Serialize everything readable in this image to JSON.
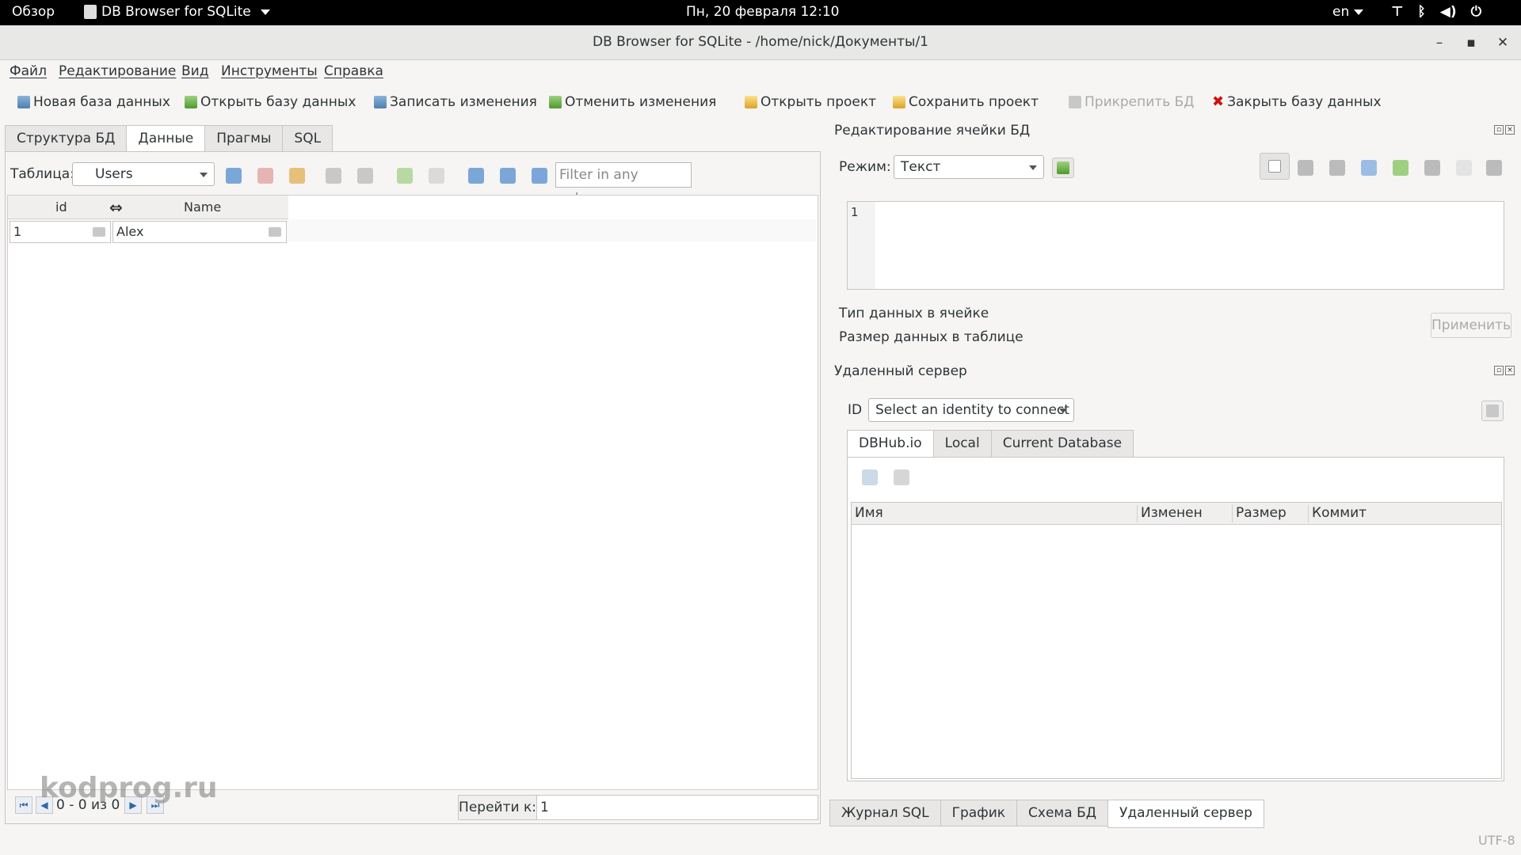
{
  "topbar": {
    "overview": "Обзор",
    "app_name": "DB Browser for SQLite",
    "clock": "Пн, 20 февраля  12:10",
    "lang": "en"
  },
  "window": {
    "title": "DB Browser for SQLite - /home/nick/Документы/1",
    "minimize": "–",
    "maximize": "▪",
    "close": "✕"
  },
  "menu": {
    "items": [
      "Файл",
      "Редактирование",
      "Вид",
      "Инструменты",
      "Справка"
    ]
  },
  "toolbar": {
    "new_db": "Новая база данных",
    "open_db": "Открыть базу данных",
    "write_changes": "Записать изменения",
    "revert_changes": "Отменить изменения",
    "open_project": "Открыть проект",
    "save_project": "Сохранить проект",
    "attach_db": "Прикрепить БД",
    "close_db": "Закрыть базу данных"
  },
  "left_tabs": [
    "Структура БД",
    "Данные",
    "Прагмы",
    "SQL"
  ],
  "browse": {
    "table_label": "Таблица:",
    "table_value": "Users",
    "filter_placeholder": "Filter in any column",
    "columns": [
      "id",
      "Name"
    ],
    "rows": [
      [
        "1",
        "Alex"
      ]
    ],
    "record_count": "0 - 0 из 0",
    "goto_label": "Перейти к:",
    "goto_value": "1"
  },
  "watermark": "kodprog.ru",
  "edit_cell": {
    "title": "Редактирование ячейки БД",
    "mode_label": "Режим:",
    "mode_value": "Текст",
    "line_number": "1",
    "type_label": "Тип данных в ячейке",
    "size_label": "Размер данных в таблице",
    "apply": "Применить"
  },
  "remote": {
    "title": "Удаленный сервер",
    "id_label": "ID",
    "identity_value": "Select an identity to connect",
    "tabs": [
      "DBHub.io",
      "Local",
      "Current Database"
    ],
    "columns": [
      "Имя",
      "Изменен",
      "Размер",
      "Коммит"
    ]
  },
  "bottom_tabs": [
    "Журнал SQL",
    "График",
    "Схема БД",
    "Удаленный сервер"
  ],
  "status": {
    "encoding": "UTF-8"
  }
}
